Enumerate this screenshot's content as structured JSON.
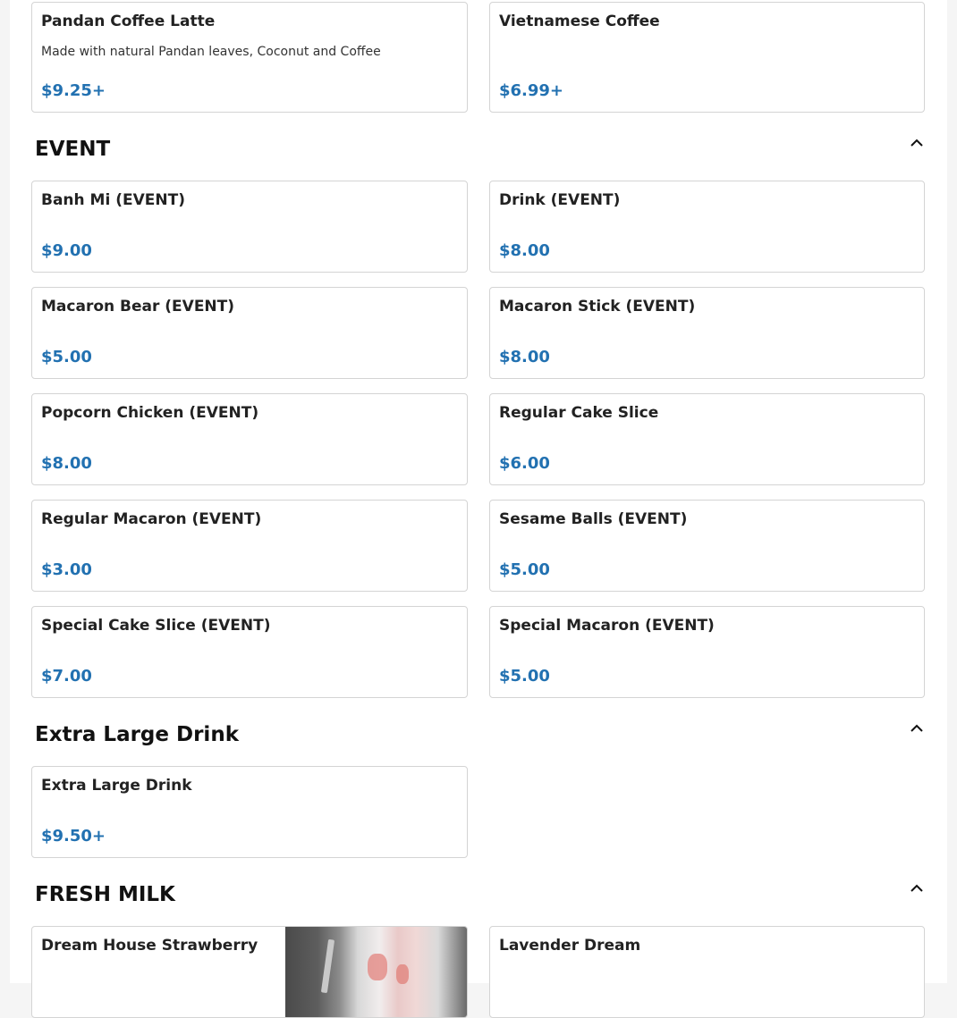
{
  "colors": {
    "price": "#2271b1",
    "border": "#d4d4d4"
  },
  "top_items": [
    {
      "name": "Pandan Coffee Latte",
      "description": "Made with natural Pandan leaves, Coconut and Coffee",
      "price": "$9.25+"
    },
    {
      "name": "Vietnamese Coffee",
      "price": "$6.99+"
    }
  ],
  "sections": {
    "event": {
      "title": "EVENT",
      "toggle_icon": "chevron-up-icon",
      "items": [
        {
          "name": "Banh Mi (EVENT)",
          "price": "$9.00"
        },
        {
          "name": "Drink (EVENT)",
          "price": "$8.00"
        },
        {
          "name": "Macaron Bear (EVENT)",
          "price": "$5.00"
        },
        {
          "name": "Macaron Stick (EVENT)",
          "price": "$8.00"
        },
        {
          "name": "Popcorn Chicken (EVENT)",
          "price": "$8.00"
        },
        {
          "name": "Regular Cake Slice",
          "price": "$6.00"
        },
        {
          "name": "Regular Macaron (EVENT)",
          "price": "$3.00"
        },
        {
          "name": "Sesame Balls (EVENT)",
          "price": "$5.00"
        },
        {
          "name": "Special Cake Slice (EVENT)",
          "price": "$7.00"
        },
        {
          "name": "Special Macaron (EVENT)",
          "price": "$5.00"
        }
      ]
    },
    "extra_large": {
      "title": "Extra Large Drink",
      "toggle_icon": "chevron-up-icon",
      "items": [
        {
          "name": "Extra Large Drink",
          "price": "$9.50+"
        }
      ]
    },
    "fresh_milk": {
      "title": "FRESH MILK",
      "toggle_icon": "chevron-up-icon",
      "items": [
        {
          "name": "Dream House Strawberry",
          "image": "strawberry-milk-drink-photo"
        },
        {
          "name": "Lavender Dream"
        }
      ]
    }
  }
}
